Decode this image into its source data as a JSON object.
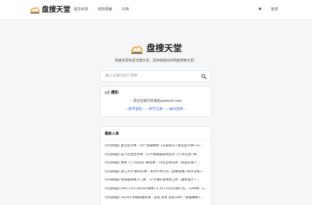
{
  "header": {
    "logo_icon": "cloud-icon",
    "site_name": "盘搜天堂",
    "nav": [
      "提交资源",
      "侵权屏蔽",
      "文档"
    ],
    "settings_icon": "gear-icon",
    "login_label": "登录"
  },
  "hero": {
    "logo_icon": "cloud-icon",
    "title": "盘搜天堂",
    "subtitle": "网盘资源免费无偿分享，坚持做最好的网盘搜索天堂！"
  },
  "search": {
    "placeholder": "输入关键词进行搜索",
    "icon": "search-icon"
  },
  "notice": {
    "icon": "megaphone-icon",
    "title": "通知",
    "bolt_icon": "lightning-icon",
    "message": "请记住我们的域名pansott.com",
    "links": "—账号登陆——账号注册——每日签到—"
  },
  "recent": {
    "title": "最新入库",
    "items": [
      "[夸克网盘] 复旦哲学课｜20个命题解析《认知提升+复旦哲学课+21…",
      "[夸克网盘] 成人社会生存课｜12节课掌握职场生存《人际交往+情…",
      "[夸克网盘] 费勇《了凡四训》解读课｜10堂立命法则（命运实践+…",
      "[夸克网盘] 浙江大学·腾讯论课｜英文学术写作（战略思维+经济决策+…",
      "[夸克网盘] 零基础表格入门课｜12节课从会用到上色（角色设计+…",
      "[夸克网盘] Allel 3.45 Docker镜像+3.35 Linux可执行包｜130MB（x…",
      "[夸克网盘] 2024小文线获胜影课｜美育 善育 美育180L（发展赛纳+…"
    ]
  },
  "colors": {
    "accent": "#3a6fd8",
    "logo_orange": "#f2a32b",
    "background": "#f5f6f7"
  }
}
